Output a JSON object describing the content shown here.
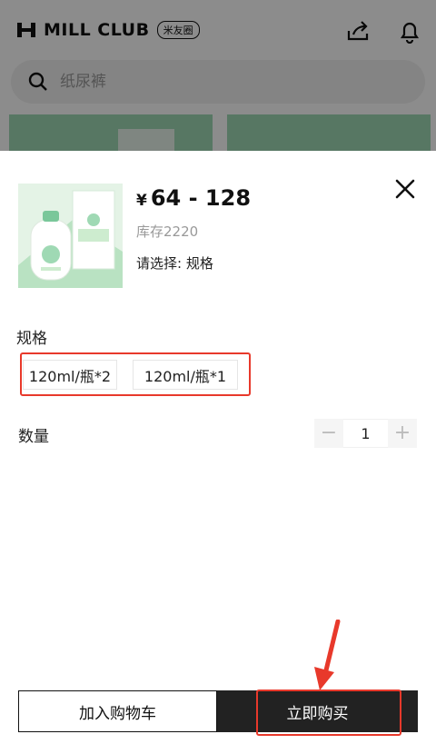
{
  "header": {
    "brand_name": "MILL CLUB",
    "brand_badge": "米友圈",
    "icons": [
      "mill-logo-icon",
      "share-icon",
      "bell-icon"
    ]
  },
  "search": {
    "placeholder": "纸尿裤",
    "icon": "search-icon"
  },
  "product": {
    "currency": "¥",
    "price_range": "64 - 128",
    "stock": "库存2220",
    "select_hint": "请选择: 规格"
  },
  "spec": {
    "title": "规格",
    "options": [
      "120ml/瓶*2",
      "120ml/瓶*1"
    ]
  },
  "quantity": {
    "title": "数量",
    "decrease": "−",
    "value": "1",
    "increase": "+"
  },
  "actions": {
    "add_to_cart": "加入购物车",
    "buy_now": "立即购买"
  },
  "colors": {
    "highlight": "#e8392b",
    "dark_button": "#222222",
    "banner_green": "#9fd9b4"
  }
}
